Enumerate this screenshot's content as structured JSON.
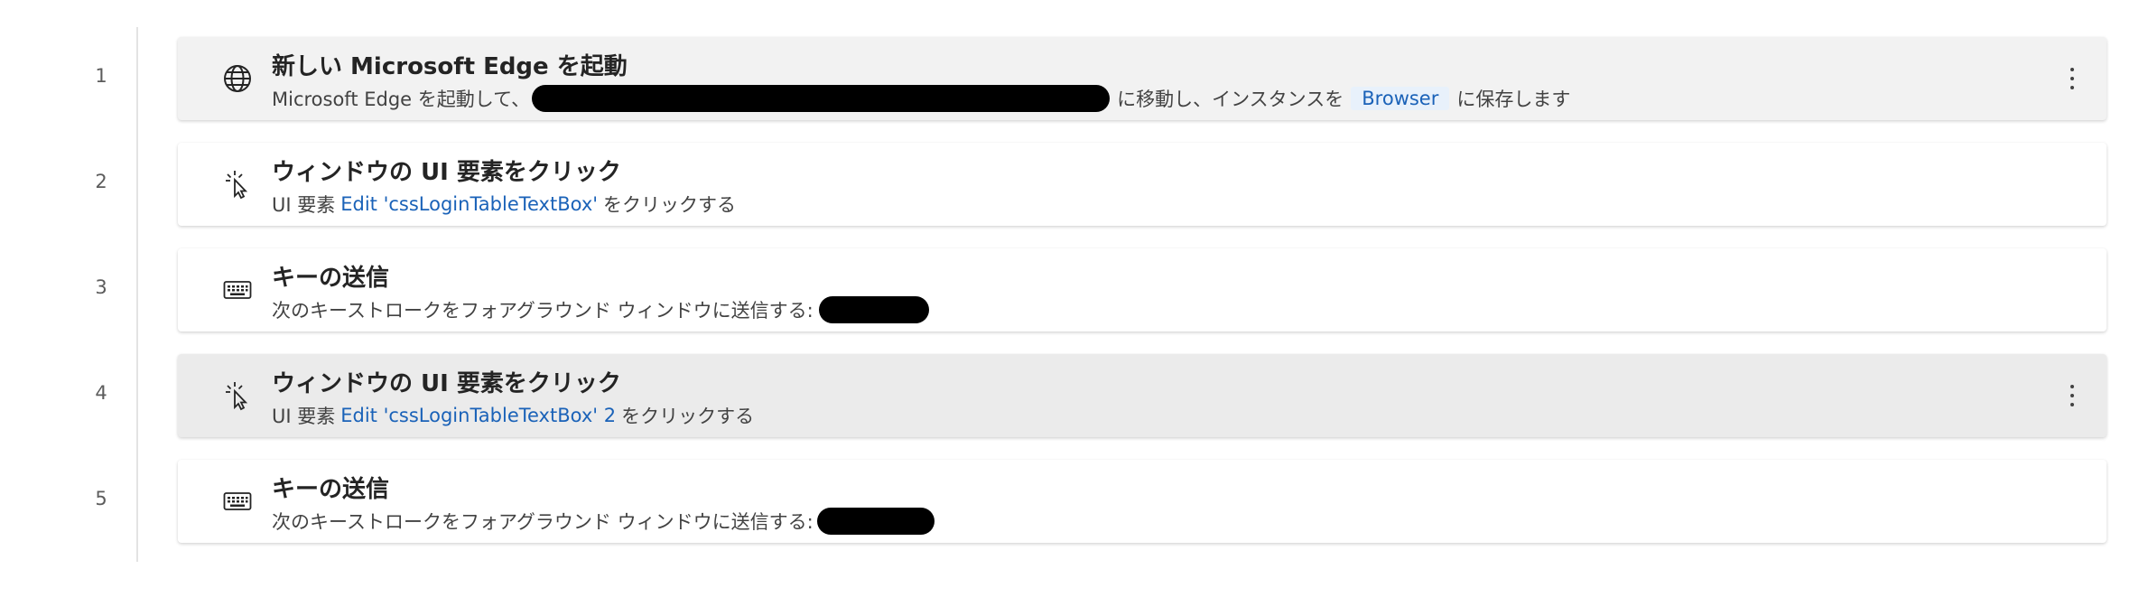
{
  "steps": [
    {
      "number": "1",
      "title": "新しい Microsoft Edge を起動",
      "desc_prefix": "Microsoft Edge を起動して、",
      "desc_middle": "に移動し、インスタンスを",
      "variable": "Browser",
      "desc_suffix": "に保存します",
      "icon": "globe-icon"
    },
    {
      "number": "2",
      "title": "ウィンドウの UI 要素をクリック",
      "desc_prefix": "UI 要素",
      "element": "Edit 'cssLoginTableTextBox'",
      "desc_suffix": "をクリックする",
      "icon": "click-cursor-icon"
    },
    {
      "number": "3",
      "title": "キーの送信",
      "desc_prefix": "次のキーストロークをフォアグラウンド ウィンドウに送信する:",
      "icon": "keyboard-icon"
    },
    {
      "number": "4",
      "title": "ウィンドウの UI 要素をクリック",
      "desc_prefix": "UI 要素",
      "element": "Edit 'cssLoginTableTextBox' 2",
      "desc_suffix": "をクリックする",
      "icon": "click-cursor-icon"
    },
    {
      "number": "5",
      "title": "キーの送信",
      "desc_prefix": "次のキーストロークをフォアグラウンド ウィンドウに送信する:",
      "icon": "keyboard-icon"
    }
  ]
}
